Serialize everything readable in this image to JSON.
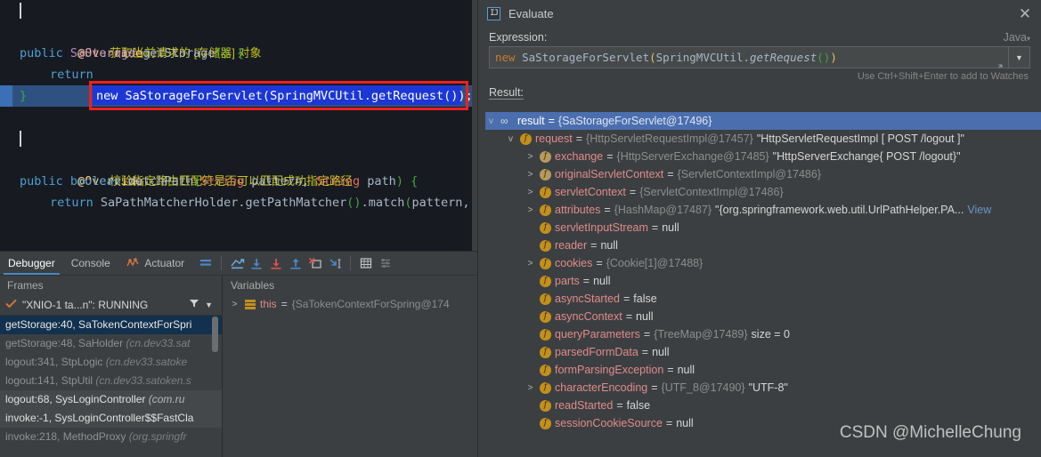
{
  "editor": {
    "lines": [
      {
        "kind": "doc",
        "text": "获取当前请求的 [存储器] 对象"
      },
      {
        "kind": "code",
        "text": "@Override",
        "cls": "annot"
      },
      {
        "kind": "code",
        "text": "public SaStorage getStorage() {"
      },
      {
        "kind": "exec",
        "prefix": "return ",
        "selected": "new SaStorageForServlet(SpringMVCUtil.getRequest());"
      },
      {
        "kind": "code",
        "text": "}"
      },
      {
        "kind": "blank",
        "text": ""
      },
      {
        "kind": "doc",
        "text": "校验指定路由匹配符是否可以匹配成功指定路径"
      },
      {
        "kind": "code",
        "text": "@Override",
        "cls": "annot"
      },
      {
        "kind": "code",
        "text": "public boolean matchPath(String pattern, String path) {"
      },
      {
        "kind": "code",
        "text": "return SaPathMatcherHolder.getPathMatcher().match(pattern, p"
      }
    ]
  },
  "debugger": {
    "tabs": [
      {
        "label": "Debugger",
        "active": true,
        "icon": null
      },
      {
        "label": "Console",
        "active": false,
        "icon": null
      },
      {
        "label": "Actuator",
        "active": false,
        "icon": "actuator-icon"
      }
    ],
    "toolbar_icons": [
      "mute-breakpoints-icon",
      "show-execution-point-icon",
      "step-over-icon",
      "step-into-icon",
      "step-out-icon",
      "force-step-into-icon",
      "run-to-cursor-icon",
      "evaluate-expression-icon",
      "settings-icon"
    ],
    "frames": {
      "title": "Frames",
      "thread": "\"XNIO-1 ta...n\": RUNNING",
      "thread_state_icon": "check-icon",
      "filter_icon": "filter-icon",
      "dropdown_icon": "chevron-down-icon",
      "rows": [
        {
          "text": "getStorage:40, SaTokenContextForSpri",
          "pkg": "",
          "style": "selected"
        },
        {
          "text": "getStorage:48, SaHolder ",
          "pkg": "(cn.dev33.sat",
          "style": "lib"
        },
        {
          "text": "logout:341, StpLogic ",
          "pkg": "(cn.dev33.satoke",
          "style": "lib"
        },
        {
          "text": "logout:141, StpUtil ",
          "pkg": "(cn.dev33.satoken.s",
          "style": "lib"
        },
        {
          "text": "logout:68, SysLoginController ",
          "pkg": "(com.ru",
          "style": "own"
        },
        {
          "text": "invoke:-1, SysLoginController$$FastCla",
          "pkg": "",
          "style": "own"
        },
        {
          "text": "invoke:218, MethodProxy ",
          "pkg": "(org.springfr",
          "style": "lib"
        }
      ]
    },
    "variables": {
      "title": "Variables",
      "rows": [
        {
          "arrow": ">",
          "icon": "stack-frame-icon",
          "name": "this",
          "eq": "=",
          "value": "{SaTokenContextForSpring@174"
        }
      ]
    }
  },
  "evaluate": {
    "title": "Evaluate",
    "app_icon": "intellij-idea-icon",
    "close_icon": "close-icon",
    "expression_label": "Expression:",
    "language": "Java",
    "language_caret": "caret-down-icon",
    "expression_value": "new SaStorageForServlet(SpringMVCUtil.getRequest())",
    "expand_icon": "expand-diagonal-icon",
    "dropdown_icon": "chevron-down-icon",
    "hint": "Use Ctrl+Shift+Enter to add to Watches",
    "result_label": "Result:",
    "tree": [
      {
        "indent": 0,
        "arrow": "v",
        "icon": "oo",
        "name": "result",
        "eq": "=",
        "ref": "{SaStorageForServlet@17496}",
        "lit": "",
        "selected": true
      },
      {
        "indent": 1,
        "arrow": "v",
        "icon": "f",
        "name": "request",
        "eq": "=",
        "ref": "{HttpServletRequestImpl@17457}",
        "lit": "\"HttpServletRequestImpl [ POST /logout ]\""
      },
      {
        "indent": 2,
        "arrow": ">",
        "icon": "f-dim",
        "name": "exchange",
        "eq": "=",
        "ref": "{HttpServerExchange@17485}",
        "lit": "\"HttpServerExchange{ POST /logout}\""
      },
      {
        "indent": 2,
        "arrow": ">",
        "icon": "f-dim",
        "name": "originalServletContext",
        "eq": "=",
        "ref": "{ServletContextImpl@17486}",
        "lit": ""
      },
      {
        "indent": 2,
        "arrow": ">",
        "icon": "f",
        "name": "servletContext",
        "eq": "=",
        "ref": "{ServletContextImpl@17486}",
        "lit": ""
      },
      {
        "indent": 2,
        "arrow": ">",
        "icon": "f",
        "name": "attributes",
        "eq": "=",
        "ref": "{HashMap@17487}",
        "lit": "\"{org.springframework.web.util.UrlPathHelper.PA...",
        "view": "View"
      },
      {
        "indent": 2,
        "arrow": "none",
        "icon": "f",
        "name": "servletInputStream",
        "eq": "=",
        "ref": "",
        "lit": "null"
      },
      {
        "indent": 2,
        "arrow": "none",
        "icon": "f",
        "name": "reader",
        "eq": "=",
        "ref": "",
        "lit": "null"
      },
      {
        "indent": 2,
        "arrow": ">",
        "icon": "f",
        "name": "cookies",
        "eq": "=",
        "ref": "{Cookie[1]@17488}",
        "lit": ""
      },
      {
        "indent": 2,
        "arrow": "none",
        "icon": "f",
        "name": "parts",
        "eq": "=",
        "ref": "",
        "lit": "null"
      },
      {
        "indent": 2,
        "arrow": "none",
        "icon": "f",
        "name": "asyncStarted",
        "eq": "=",
        "ref": "",
        "lit": "false"
      },
      {
        "indent": 2,
        "arrow": "none",
        "icon": "f",
        "name": "asyncContext",
        "eq": "=",
        "ref": "",
        "lit": "null"
      },
      {
        "indent": 2,
        "arrow": "none",
        "icon": "f",
        "name": "queryParameters",
        "eq": "=",
        "ref": "{TreeMap@17489}",
        "lit": "size = 0"
      },
      {
        "indent": 2,
        "arrow": "none",
        "icon": "f",
        "name": "parsedFormData",
        "eq": "=",
        "ref": "",
        "lit": "null"
      },
      {
        "indent": 2,
        "arrow": "none",
        "icon": "f",
        "name": "formParsingException",
        "eq": "=",
        "ref": "",
        "lit": "null"
      },
      {
        "indent": 2,
        "arrow": ">",
        "icon": "f",
        "name": "characterEncoding",
        "eq": "=",
        "ref": "{UTF_8@17490}",
        "lit": "\"UTF-8\""
      },
      {
        "indent": 2,
        "arrow": "none",
        "icon": "f",
        "name": "readStarted",
        "eq": "=",
        "ref": "",
        "lit": "false"
      },
      {
        "indent": 2,
        "arrow": "none",
        "icon": "f",
        "name": "sessionCookieSource",
        "eq": "=",
        "ref": "",
        "lit": "null"
      }
    ],
    "watermark": "CSDN @MichelleChung"
  },
  "colors": {
    "panel_bg": "#3c3f41",
    "editor_bg": "#171a21",
    "selection_blue": "#1c37d6",
    "annotation_red": "#ef2020",
    "tree_selection": "#4b6eaf",
    "accent_blue": "#4a88c7",
    "field_name": "#e08b8b",
    "doc_comment": "#c4c41f"
  }
}
